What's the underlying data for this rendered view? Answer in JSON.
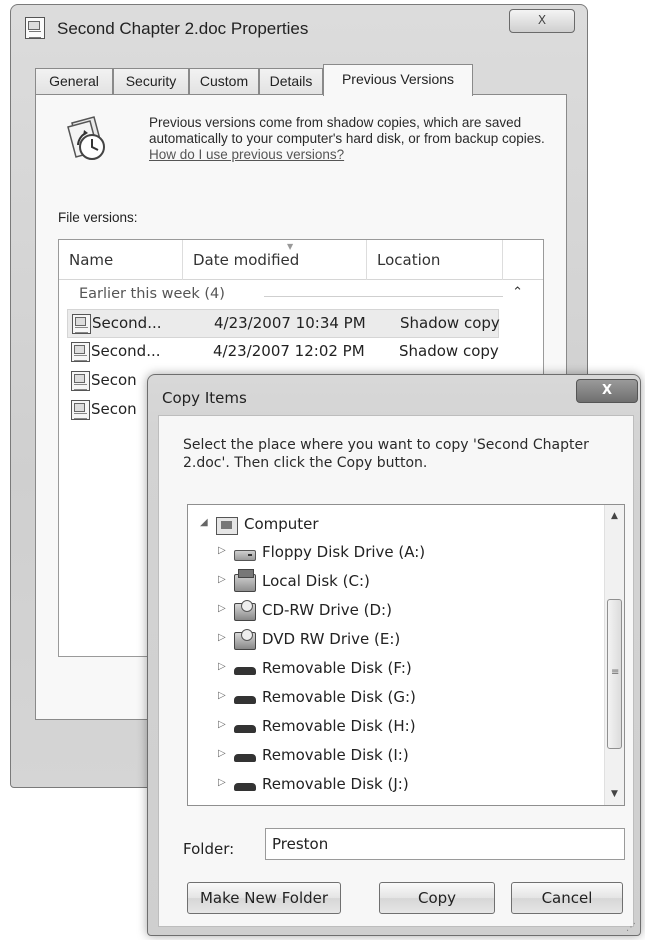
{
  "properties_window": {
    "title": "Second Chapter 2.doc Properties",
    "close_glyph": "X",
    "tabs": [
      {
        "label": "General",
        "active": false
      },
      {
        "label": "Security",
        "active": false
      },
      {
        "label": "Custom",
        "active": false
      },
      {
        "label": "Details",
        "active": false
      },
      {
        "label": "Previous Versions",
        "active": true
      }
    ],
    "intro_text": "Previous versions come from shadow copies, which are saved automatically to your computer's hard disk, or from backup copies. ",
    "intro_link": "How do I use previous versions?",
    "file_versions_label": "File versions:",
    "columns": [
      "Name",
      "Date modified",
      "Location"
    ],
    "group_label": "Earlier this week (4)",
    "rows": [
      {
        "name": "Second...",
        "date": "4/23/2007 10:34 PM",
        "location": "Shadow copy",
        "selected": true
      },
      {
        "name": "Second...",
        "date": "4/23/2007 12:02 PM",
        "location": "Shadow copy",
        "selected": false
      },
      {
        "name": "Secon",
        "date": "",
        "location": "",
        "selected": false
      },
      {
        "name": "Secon",
        "date": "",
        "location": "",
        "selected": false
      }
    ]
  },
  "copy_dialog": {
    "title": "Copy Items",
    "close_glyph": "X",
    "instruction": "Select the place where you want to copy 'Second Chapter 2.doc'. Then click the Copy button.",
    "tree": [
      {
        "label": "Computer",
        "icon": "computer-icon",
        "expander": "◢",
        "level": 0
      },
      {
        "label": "Floppy Disk Drive (A:)",
        "icon": "floppy-drive-icon",
        "expander": "▷",
        "level": 1
      },
      {
        "label": "Local Disk (C:)",
        "icon": "local-disk-icon",
        "expander": "▷",
        "level": 1
      },
      {
        "label": "CD-RW Drive (D:)",
        "icon": "cd-drive-icon",
        "expander": "▷",
        "level": 1
      },
      {
        "label": "DVD RW Drive (E:)",
        "icon": "dvd-drive-icon",
        "expander": "▷",
        "level": 1
      },
      {
        "label": "Removable Disk (F:)",
        "icon": "removable-disk-icon",
        "expander": "▷",
        "level": 1
      },
      {
        "label": "Removable Disk (G:)",
        "icon": "removable-disk-icon",
        "expander": "▷",
        "level": 1
      },
      {
        "label": "Removable Disk (H:)",
        "icon": "removable-disk-icon",
        "expander": "▷",
        "level": 1
      },
      {
        "label": "Removable Disk (I:)",
        "icon": "removable-disk-icon",
        "expander": "▷",
        "level": 1
      },
      {
        "label": "Removable Disk (J:)",
        "icon": "removable-disk-icon",
        "expander": "▷",
        "level": 1
      }
    ],
    "folder_label": "Folder:",
    "folder_value": "Preston",
    "buttons": {
      "make_new_folder": "Make New Folder",
      "copy": "Copy",
      "cancel": "Cancel"
    }
  }
}
